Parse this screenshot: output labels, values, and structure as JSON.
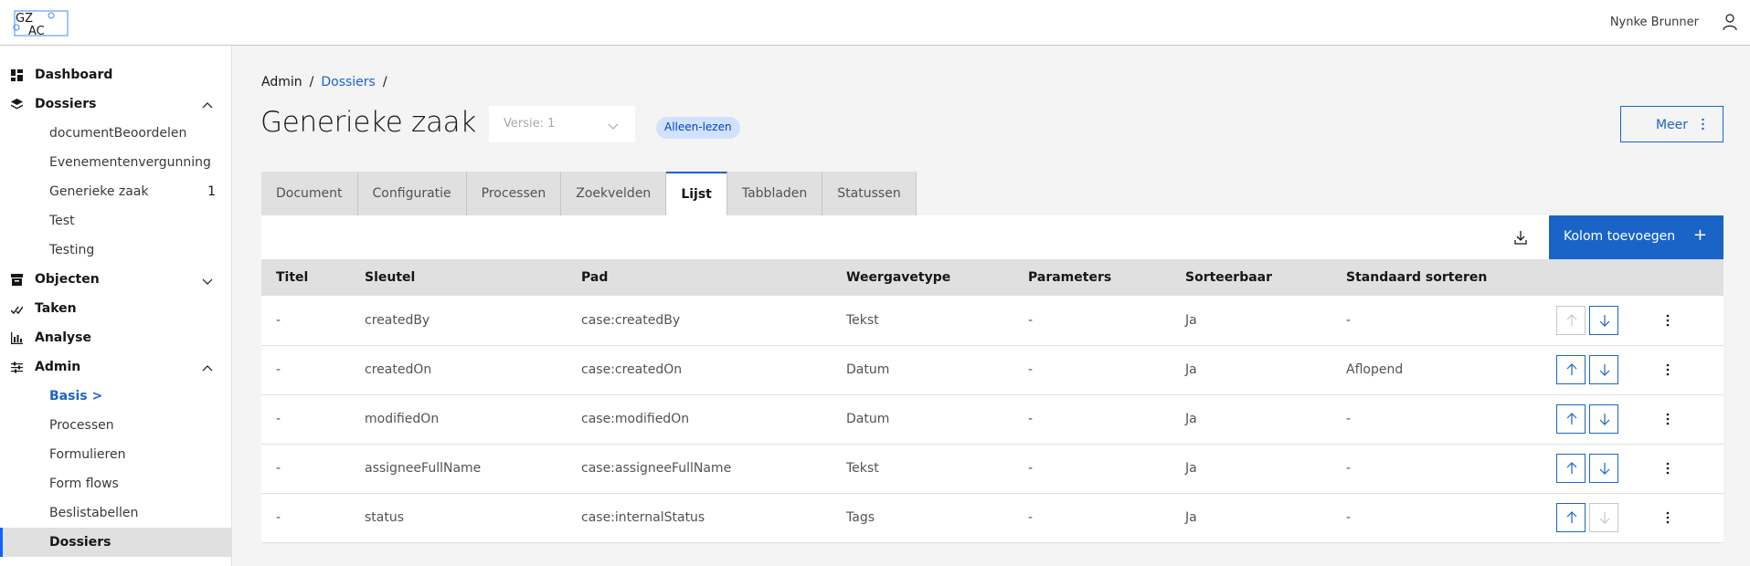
{
  "header": {
    "logo_text_top": "GZ",
    "logo_text_bottom": "AC",
    "user_name": "Nynke Brunner"
  },
  "sidebar": {
    "items": [
      {
        "label": "Dashboard",
        "icon": "dashboard-icon"
      },
      {
        "label": "Dossiers",
        "icon": "layers-icon",
        "expanded": true
      },
      {
        "label": "documentBeoordelen"
      },
      {
        "label": "Evenementenvergunning"
      },
      {
        "label": "Generieke zaak",
        "count": "1"
      },
      {
        "label": "Test"
      },
      {
        "label": "Testing"
      },
      {
        "label": "Objecten",
        "icon": "archive-icon",
        "expanded": false
      },
      {
        "label": "Taken",
        "icon": "checkmark-icon"
      },
      {
        "label": "Analyse",
        "icon": "chart-icon"
      },
      {
        "label": "Admin",
        "icon": "settings-adjust-icon",
        "expanded": true
      },
      {
        "label": "Basis >"
      },
      {
        "label": "Processen"
      },
      {
        "label": "Formulieren"
      },
      {
        "label": "Form flows"
      },
      {
        "label": "Beslistabellen"
      },
      {
        "label": "Dossiers"
      }
    ]
  },
  "breadcrumb": {
    "items": [
      "Admin",
      "/",
      "Dossiers",
      "/"
    ]
  },
  "page": {
    "title": "Generieke zaak",
    "version_placeholder": "Versie: 1",
    "badge": "Alleen-lezen",
    "more_button": "Meer"
  },
  "tabs": [
    "Document",
    "Configuratie",
    "Processen",
    "Zoekvelden",
    "Lijst",
    "Tabbladen",
    "Statussen"
  ],
  "active_tab": "Lijst",
  "toolbar": {
    "add_column_button": "Kolom toevoegen",
    "add_icon": "+"
  },
  "table": {
    "headers": [
      "Titel",
      "Sleutel",
      "Pad",
      "Weergavetype",
      "Parameters",
      "Sorteerbaar",
      "Standaard sorteren"
    ],
    "rows": [
      {
        "titel": "-",
        "sleutel": "createdBy",
        "pad": "case:createdBy",
        "weergave": "Tekst",
        "param": "-",
        "sort": "Ja",
        "std": "-",
        "up_enabled": false,
        "down_enabled": true
      },
      {
        "titel": "-",
        "sleutel": "createdOn",
        "pad": "case:createdOn",
        "weergave": "Datum",
        "param": "-",
        "sort": "Ja",
        "std": "Aflopend",
        "up_enabled": true,
        "down_enabled": true
      },
      {
        "titel": "-",
        "sleutel": "modifiedOn",
        "pad": "case:modifiedOn",
        "weergave": "Datum",
        "param": "-",
        "sort": "Ja",
        "std": "-",
        "up_enabled": true,
        "down_enabled": true
      },
      {
        "titel": "-",
        "sleutel": "assigneeFullName",
        "pad": "case:assigneeFullName",
        "weergave": "Tekst",
        "param": "-",
        "sort": "Ja",
        "std": "-",
        "up_enabled": true,
        "down_enabled": true
      },
      {
        "titel": "-",
        "sleutel": "status",
        "pad": "case:internalStatus",
        "weergave": "Tags",
        "param": "-",
        "sort": "Ja",
        "std": "-",
        "up_enabled": true,
        "down_enabled": false
      }
    ]
  },
  "colors": {
    "accent": "#1a64c8",
    "badge_bg": "#d0e2ff",
    "disabled": "#c6c6c6"
  }
}
